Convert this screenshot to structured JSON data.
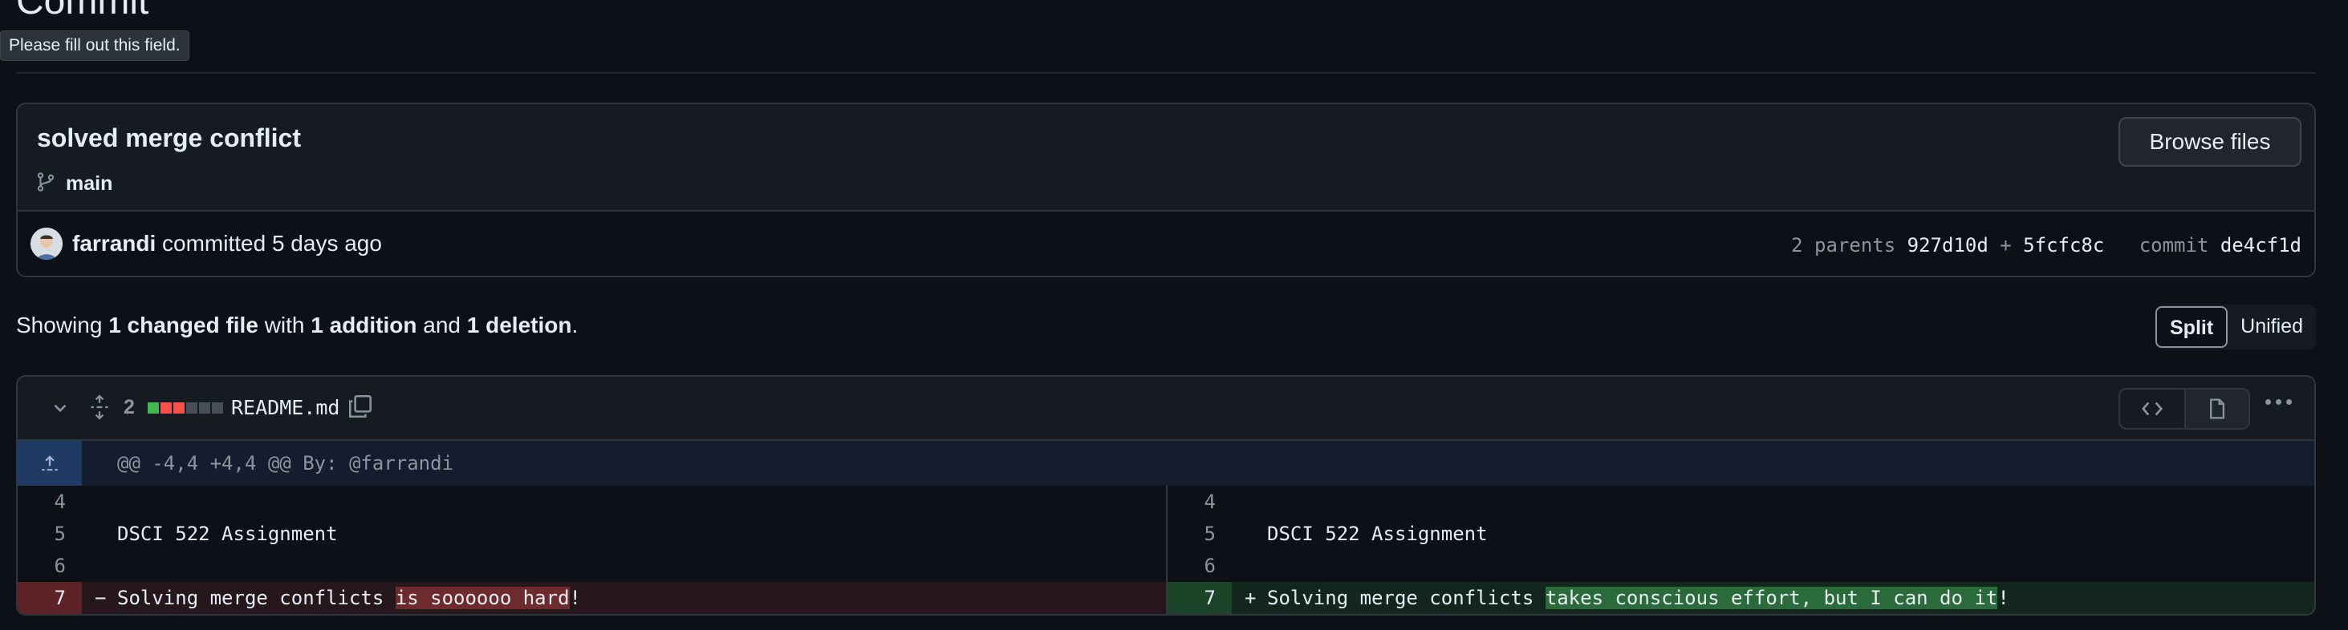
{
  "page": {
    "heading": "Commit",
    "tooltip": "Please fill out this field."
  },
  "commit": {
    "title": "solved merge conflict",
    "branch": "main",
    "browse_label": "Browse files",
    "author": "farrandi",
    "action": "committed 5 days ago",
    "parents_label": "2 parents",
    "parent1": "927d10d",
    "plus": "+",
    "parent2": "5fcfc8c",
    "commit_label": "commit",
    "sha": "de4cf1d"
  },
  "summary": {
    "showing": "Showing",
    "files": "1 changed file",
    "with": "with",
    "additions": "1 addition",
    "and": "and",
    "deletions": "1 deletion",
    "period": "."
  },
  "view_toggle": {
    "split": "Split",
    "unified": "Unified",
    "active": "Split"
  },
  "diff": {
    "changes": "2",
    "filename": "README.md",
    "hunk_header": "@@ -4,4 +4,4 @@ By: @farrandi",
    "left": {
      "rows": [
        {
          "num": "4",
          "text": ""
        },
        {
          "num": "5",
          "text": "DSCI 522 Assignment"
        },
        {
          "num": "6",
          "text": ""
        }
      ],
      "deleted": {
        "num": "7",
        "marker": "−",
        "prefix": "Solving merge conflicts ",
        "highlight": "is soooooo hard",
        "suffix": "!"
      }
    },
    "right": {
      "rows": [
        {
          "num": "4",
          "text": ""
        },
        {
          "num": "5",
          "text": "DSCI 522 Assignment"
        },
        {
          "num": "6",
          "text": ""
        }
      ],
      "added": {
        "num": "7",
        "marker": "+",
        "prefix": "Solving merge conflicts ",
        "highlight": "takes conscious effort, but I can do it",
        "suffix": "!"
      }
    },
    "diffstat_colors": [
      "#3fb950",
      "#f85149",
      "#f85149",
      "#484f58",
      "#484f58",
      "#484f58"
    ]
  }
}
